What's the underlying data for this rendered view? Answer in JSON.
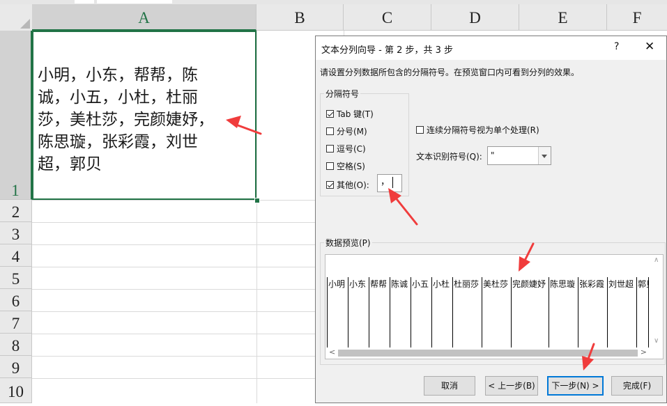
{
  "sheet": {
    "columns": [
      "A",
      "B",
      "C",
      "D",
      "E",
      "F"
    ],
    "selected_column": "A",
    "rows": [
      "1",
      "2",
      "3",
      "4",
      "5",
      "6",
      "7",
      "8",
      "9",
      "10"
    ],
    "selected_row": "1",
    "cell_a1": "小明，小东，帮帮，陈诚，小五，小杜，杜丽莎，美杜莎，完颜婕妤，陈思璇，张彩霞，刘世超，郭贝"
  },
  "dialog": {
    "title": "文本分列向导 - 第 2 步，共 3 步",
    "help": "?",
    "close": "✕",
    "instruction": "请设置分列数据所包含的分隔符号。在预览窗口内可看到分列的效果。",
    "delimiters_group": "分隔符号",
    "delimiters": [
      {
        "label": "Tab 键(T)",
        "checked": true
      },
      {
        "label": "分号(M)",
        "checked": false
      },
      {
        "label": "逗号(C)",
        "checked": false
      },
      {
        "label": "空格(S)",
        "checked": false
      },
      {
        "label": "其他(O):",
        "checked": true
      }
    ],
    "other_value": "，",
    "consecutive_label": "连续分隔符号视为单个处理(R)",
    "consecutive_checked": false,
    "qualifier_label": "文本识别符号(Q):",
    "qualifier_value": "\"",
    "preview_label": "数据预览(P)",
    "preview_columns": [
      "小明",
      "小东",
      "帮帮",
      "陈诚",
      "小五",
      "小杜",
      "杜丽莎",
      "美杜莎",
      "完颜婕妤",
      "陈思璇",
      "张彩霞",
      "刘世超",
      "郭贝"
    ],
    "buttons": {
      "cancel": "取消",
      "back": "< 上一步(B)",
      "next": "下一步(N) >",
      "finish": "完成(F)"
    }
  },
  "colors": {
    "excel_green": "#217346",
    "annotation_red": "#f03c3c",
    "focus_blue": "#0078d7"
  }
}
